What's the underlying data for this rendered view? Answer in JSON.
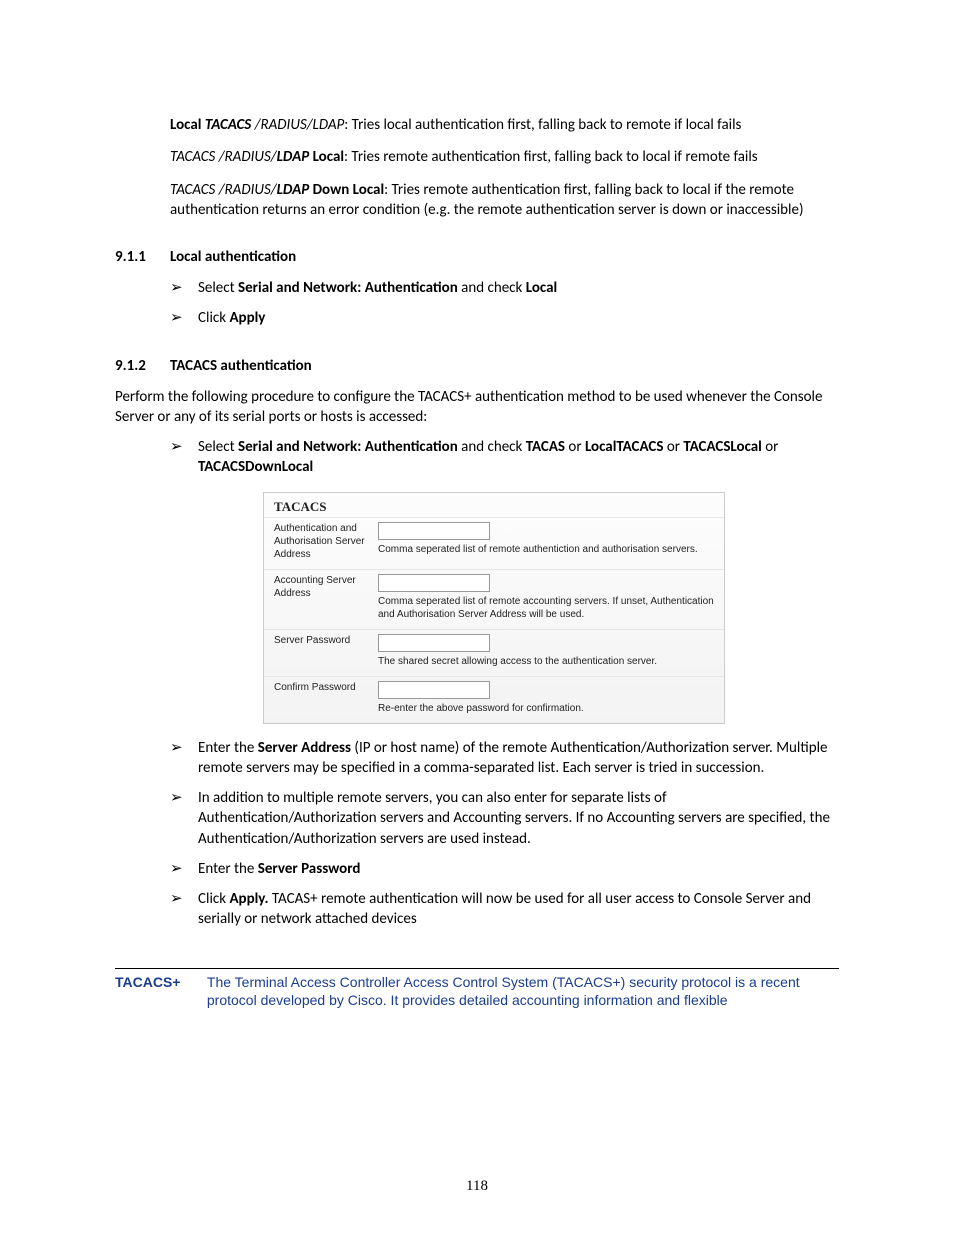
{
  "para1": {
    "prefix_bold": "Local ",
    "prefix_bolditalic": "TACACS ",
    "prefix_italic": "/RADIUS/LDAP",
    "rest": ": Tries local authentication first, falling back to remote if local fails"
  },
  "para2": {
    "prefix_italic": "TACACS /RADIUS/",
    "prefix_bolditalic": "LDAP",
    "bold": " Local",
    "rest": ": Tries remote authentication first, falling back to local if remote fails"
  },
  "para3": {
    "prefix_italic": "TACACS /RADIUS/",
    "prefix_bolditalic": "LDAP",
    "bold": " Down Local",
    "rest": ": Tries remote authentication first, falling back to local if the remote authentication returns an error condition (e.g. the remote authentication server is down or inaccessible)"
  },
  "sec911": {
    "num": "9.1.1",
    "title": "Local authentication"
  },
  "sec911_b1": {
    "t1": "Select ",
    "b1": "Serial and Network: Authentication",
    "t2": " and check ",
    "b2": "Local"
  },
  "sec911_b2": {
    "t1": "Click ",
    "b1": "Apply"
  },
  "sec912": {
    "num": "9.1.2",
    "title": "TACACS authentication"
  },
  "sec912_intro": "Perform the following procedure to configure the TACACS+ authentication method to be used whenever the Console Server or any of its serial ports or hosts is accessed:",
  "sec912_b1": {
    "t1": "Select ",
    "b1": "Serial and Network: Authentication",
    "t2": " and check  ",
    "b2": "TACAS",
    "t3": " or ",
    "b3": "LocalTACACS",
    "t4": " or ",
    "b4": "TACACSLocal",
    "t5": " or ",
    "b5": "TACACSDownLocal"
  },
  "panel": {
    "title": "TACACS",
    "row1_label": "Authentication and Authorisation Server Address",
    "row1_help": "Comma seperated list of remote authentiction and authorisation servers.",
    "row2_label": "Accounting Server Address",
    "row2_help": "Comma seperated list of remote accounting servers. If unset, Authentication and Authorisation Server Address will be used.",
    "row3_label": "Server Password",
    "row3_help": "The shared secret allowing access to the authentication server.",
    "row4_label": "Confirm Password",
    "row4_help": "Re-enter the above password for confirmation."
  },
  "sec912_b2": {
    "t1": "Enter the ",
    "b1": "Server Address",
    "t2": " (IP or host name) of the remote Authentication/Authorization server. Multiple remote servers may be specified in a comma-separated list. Each server is tried in succession."
  },
  "sec912_b3": "In addition to multiple remote servers, you can also enter for separate lists of Authentication/Authorization servers and Accounting servers. If no Accounting servers are specified, the Authentication/Authorization servers are used instead.",
  "sec912_b4": {
    "t1": "Enter the ",
    "b1": "Server Password"
  },
  "sec912_b5": {
    "t1": "Click ",
    "b1": "Apply.",
    "t2": " TACAS+ remote authentication will now be used for all user access to Console Server and serially or network attached devices"
  },
  "note": {
    "term": "TACACS+",
    "body": "The Terminal Access Controller Access Control System (TACACS+) security protocol is a recent protocol developed by Cisco. It provides detailed accounting information and flexible"
  },
  "page_number": "118"
}
